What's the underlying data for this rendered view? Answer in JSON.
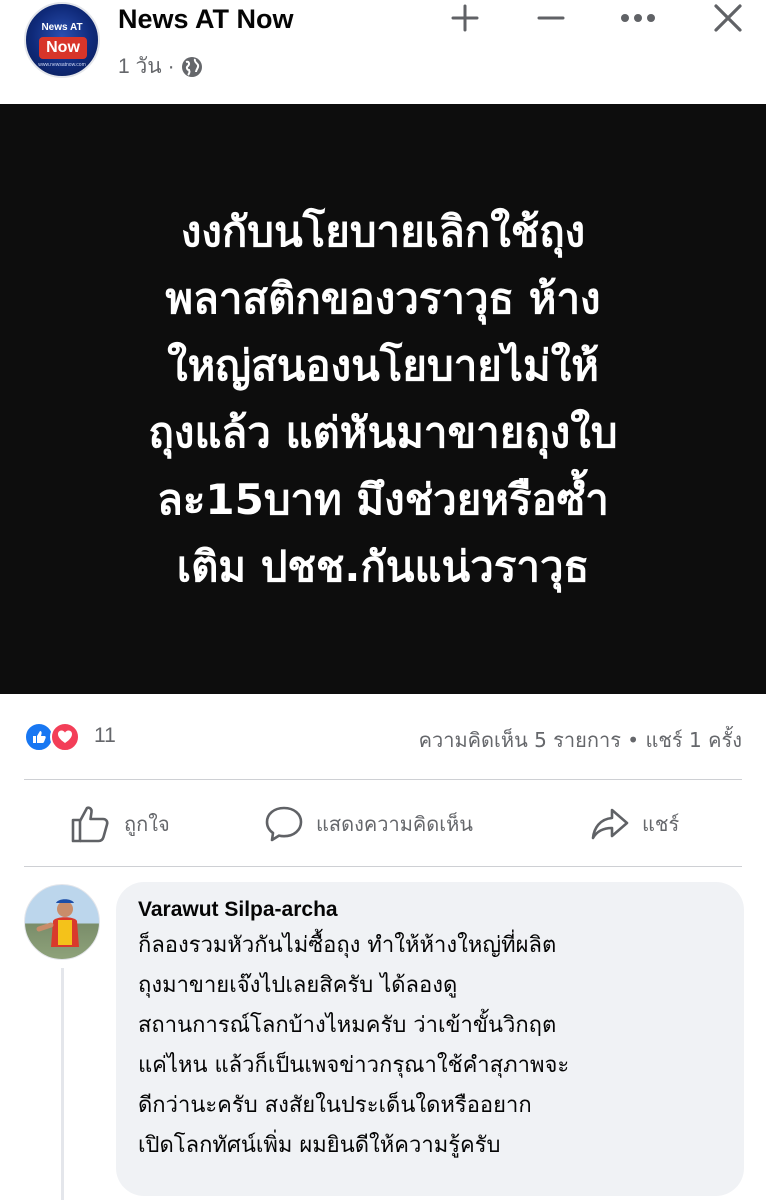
{
  "post": {
    "page_name": "News AT Now",
    "page_logo": {
      "top": "News AT",
      "main": "Now",
      "bottom": "www.newsatnow.com"
    },
    "time": "1 วัน",
    "separator": "·",
    "privacy_icon": "globe-icon",
    "header_actions": [
      "plus-icon",
      "minus-icon",
      "more-icon",
      "close-icon"
    ],
    "image_text_lines": [
      "งงกับนโยบายเลิกใช้ถุง",
      "พลาสติกของวราวุธ ห้าง",
      "ใหญ่สนองนโยบายไม่ให้",
      "ถุงแล้ว แต่หันมาขายถุงใบ",
      "ละ15บาท มึงช่วยหรือซ้ำ",
      "เติม ปชช.กันแน่วราวุธ"
    ]
  },
  "reactions": {
    "types": [
      "like",
      "love"
    ],
    "count": "11",
    "summary": "ความคิดเห็น 5 รายการ • แชร์ 1 ครั้ง"
  },
  "actions": {
    "like": "ถูกใจ",
    "comment": "แสดงความคิดเห็น",
    "share": "แชร์"
  },
  "comment": {
    "author": "Varawut Silpa-archa",
    "text_lines": [
      "ก็ลองรวมหัวกันไม่ซื้อถุง ทำให้ห้างใหญ่ที่ผลิต",
      "ถุงมาขายเจ๊งไปเลยสิครับ ได้ลองดู",
      "สถานการณ์โลกบ้างไหมครับ ว่าเข้าขั้นวิกฤต",
      "แค่ไหน แล้วก็เป็นเพจข่าวกรุณาใช้คำสุภาพจะ",
      "ดีกว่านะครับ สงสัยในประเด็นใดหรืออยาก",
      "เปิดโลกทัศน์เพิ่ม ผมยินดีให้ความรู้ครับ"
    ]
  },
  "colors": {
    "text_primary": "#050505",
    "text_secondary": "#65676b",
    "like_blue": "#1877f2",
    "love_red": "#f33e58",
    "bubble_bg": "#f0f2f5",
    "image_bg": "#0d0d0d"
  }
}
